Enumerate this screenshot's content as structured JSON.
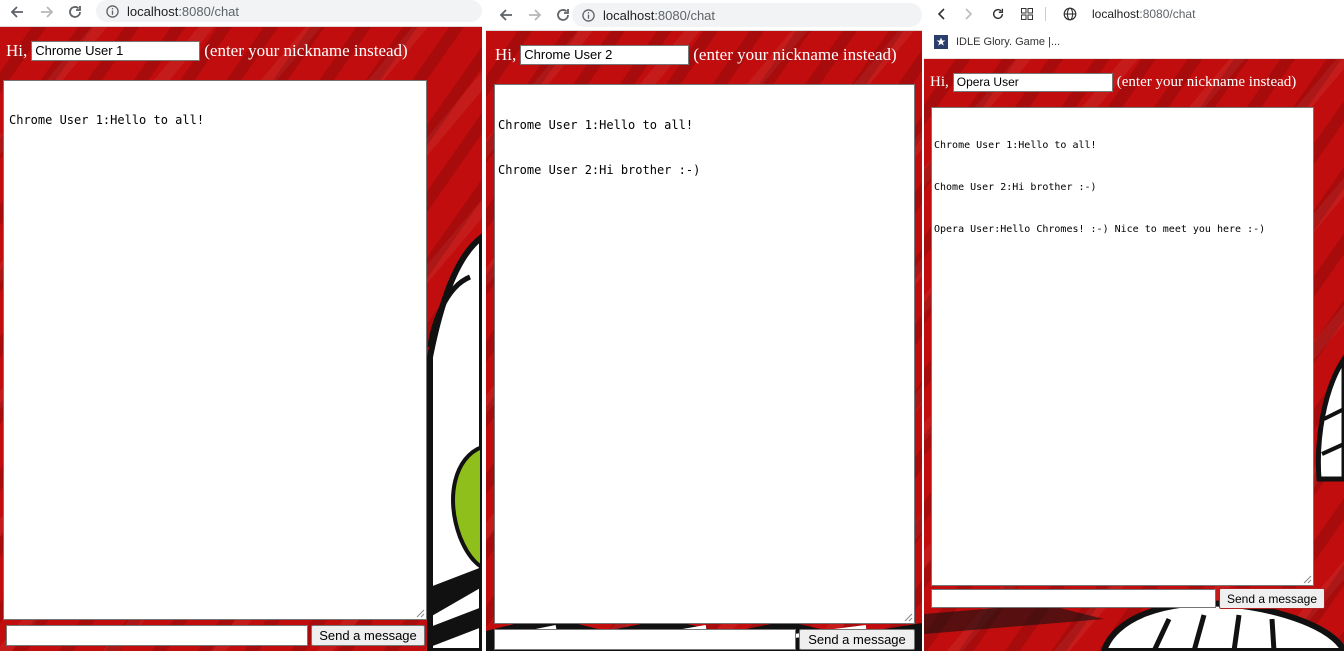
{
  "windows": [
    {
      "browser": "chrome",
      "address_bar": {
        "host": "localhost",
        "rest": ":8080/chat"
      },
      "page": {
        "greeting": "Hi,",
        "nickname_value": "Chrome User 1",
        "nickname_hint": "(enter your nickname instead)",
        "messages": [
          "Chrome User 1:Hello to all!"
        ],
        "message_input_value": "",
        "send_label": "Send a message"
      }
    },
    {
      "browser": "chrome",
      "address_bar": {
        "host": "localhost",
        "rest": ":8080/chat"
      },
      "page": {
        "greeting": "Hi,",
        "nickname_value": "Chrome User 2",
        "nickname_hint": "(enter your nickname instead)",
        "messages": [
          "Chrome User 1:Hello to all!",
          "Chrome User 2:Hi brother :-)"
        ],
        "message_input_value": "",
        "send_label": "Send a message"
      }
    },
    {
      "browser": "opera",
      "address_bar": {
        "host": "localhost",
        "rest": ":8080/chat"
      },
      "bookmarks": [
        {
          "label": "IDLE Glory. Game |..."
        }
      ],
      "page": {
        "greeting": "Hi,",
        "nickname_value": "Opera User",
        "nickname_hint": "(enter your nickname instead)",
        "messages": [
          "Chrome User 1:Hello to all!",
          "Chome User 2:Hi brother :-)",
          "Opera User:Hello Chromes! :-) Nice to meet you here :-)"
        ],
        "message_input_value": "",
        "send_label": "Send a message"
      }
    }
  ],
  "colors": {
    "page_background": "#c10d0d",
    "page_text": "#ffffff",
    "opera_button_border": "#b32020"
  },
  "icons": [
    "back-arrow-icon",
    "forward-arrow-icon",
    "reload-icon",
    "info-icon",
    "speed-dial-icon",
    "globe-icon",
    "bookmark-favicon"
  ]
}
